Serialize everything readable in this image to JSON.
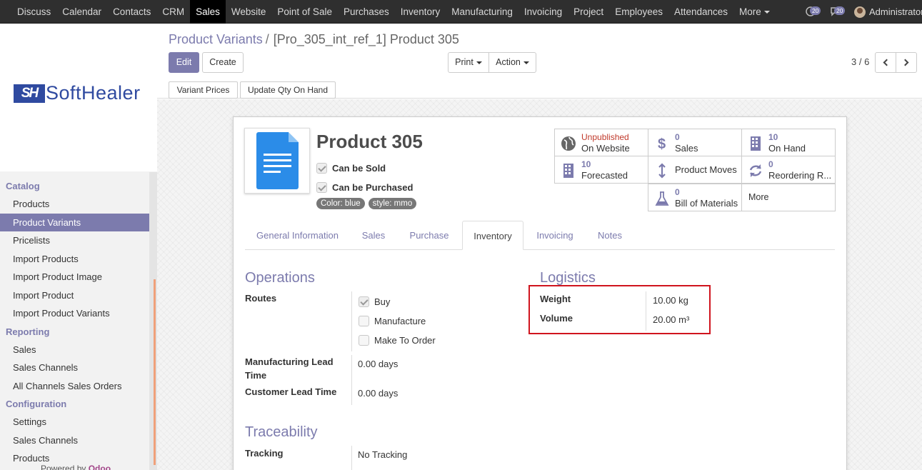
{
  "topbar": {
    "menu": [
      "Discuss",
      "Calendar",
      "Contacts",
      "CRM",
      "Sales",
      "Website",
      "Point of Sale",
      "Purchases",
      "Inventory",
      "Manufacturing",
      "Invoicing",
      "Project",
      "Employees",
      "Attendances",
      "More"
    ],
    "active": "Sales",
    "activity_count": "20",
    "message_count": "20",
    "user": "Administrator"
  },
  "logo": {
    "mark": "SH",
    "text": "SoftHealer"
  },
  "sidebar": {
    "sections": [
      {
        "title": "Catalog",
        "items": [
          "Products",
          "Product Variants",
          "Pricelists",
          "Import Products",
          "Import Product Image",
          "Import Product",
          "Import Product Variants"
        ]
      },
      {
        "title": "Reporting",
        "items": [
          "Sales",
          "Sales Channels",
          "All Channels Sales Orders"
        ]
      },
      {
        "title": "Configuration",
        "items": [
          "Settings",
          "Sales Channels",
          "Products"
        ]
      }
    ],
    "active_item": "Product Variants",
    "powered_prefix": "Powered by",
    "powered_brand": "Odoo"
  },
  "breadcrumb": {
    "parent": "Product Variants",
    "separator": "/",
    "current": "[Pro_305_int_ref_1] Product 305"
  },
  "buttons": {
    "edit": "Edit",
    "create": "Create",
    "print": "Print",
    "action": "Action",
    "variant_prices": "Variant Prices",
    "update_qty": "Update Qty On Hand"
  },
  "pager": {
    "text": "3 / 6"
  },
  "product": {
    "name": "Product 305",
    "can_be_sold": "Can be Sold",
    "can_be_purchased": "Can be Purchased",
    "tags": [
      "Color: blue",
      "style: mmo"
    ]
  },
  "stat_buttons": {
    "website_status": "Unpublished",
    "website_label": "On Website",
    "sales_value": "0",
    "sales_label": "Sales",
    "onhand_value": "10",
    "onhand_label": "On Hand",
    "forecast_value": "10",
    "forecast_label": "Forecasted",
    "moves_label": "Product Moves",
    "reorder_value": "0",
    "reorder_label": "Reordering R...",
    "bom_value": "0",
    "bom_label": "Bill of Materials",
    "more_label": "More"
  },
  "tabs": [
    "General Information",
    "Sales",
    "Purchase",
    "Inventory",
    "Invoicing",
    "Notes"
  ],
  "active_tab": "Inventory",
  "operations": {
    "title": "Operations",
    "routes_label": "Routes",
    "routes": [
      {
        "label": "Buy",
        "checked": true
      },
      {
        "label": "Manufacture",
        "checked": false
      },
      {
        "label": "Make To Order",
        "checked": false
      }
    ],
    "mfg_lead_label": "Manufacturing Lead Time",
    "mfg_lead_value": "0.00 days",
    "cust_lead_label": "Customer Lead Time",
    "cust_lead_value": "0.00 days"
  },
  "logistics": {
    "title": "Logistics",
    "weight_label": "Weight",
    "weight_value": "10.00 kg",
    "volume_label": "Volume",
    "volume_value": "20.00 m³"
  },
  "traceability": {
    "title": "Traceability",
    "tracking_label": "Tracking",
    "tracking_value": "No Tracking"
  },
  "colors": {
    "brand": "#7c7bad",
    "highlight": "#d0141e",
    "topbar": "#2f2f2f",
    "unpublished": "#c0392b"
  }
}
